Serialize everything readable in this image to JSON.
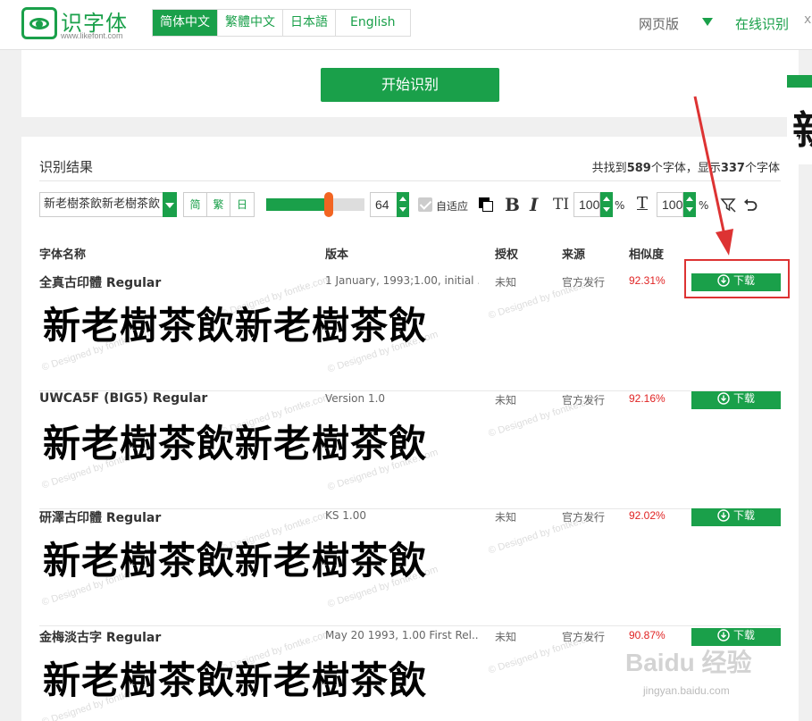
{
  "header": {
    "logo_title": "识字体",
    "logo_url": "www.likefont.com",
    "lang_tabs": [
      "简体中文",
      "繁體中文",
      "日本語",
      "English"
    ],
    "web_version": "网页版",
    "online_recognize": "在线识别",
    "close_glyph": "x"
  },
  "start": {
    "button_label": "开始识别"
  },
  "floater_glyph": "新",
  "results": {
    "title": "识别结果",
    "count_prefix": "共找到",
    "found": "589",
    "count_mid": "个字体，显示",
    "shown": "337",
    "count_suffix": "个字体"
  },
  "toolbar": {
    "sample_text": "新老樹茶飲新老樹茶飲",
    "script_buttons": [
      "简",
      "繁",
      "日"
    ],
    "size_slider_fraction": 0.64,
    "font_size": "64",
    "auto_fit_label": "自适应",
    "bold": "B",
    "italic": "I",
    "text_size_icon": "TI",
    "text_size_pct": "100",
    "letter_spacing_icon": "T",
    "letter_spacing_pct": "100",
    "pct_sign": "%"
  },
  "table": {
    "headers": [
      "字体名称",
      "版本",
      "授权",
      "来源",
      "相似度"
    ],
    "download_label": "下载",
    "preview_text": "新老樹茶飲新老樹茶飲",
    "rows": [
      {
        "name": "全真古印體 Regular",
        "version": "1 January, 1993;1.00, initial ...",
        "license": "未知",
        "source": "官方发行",
        "similarity": "92.31%"
      },
      {
        "name": "UWCA5F (BIG5) Regular",
        "version": "Version 1.0",
        "license": "未知",
        "source": "官方发行",
        "similarity": "92.16%"
      },
      {
        "name": "研澤古印體 Regular",
        "version": "KS 1.00",
        "license": "未知",
        "source": "官方发行",
        "similarity": "92.02%"
      },
      {
        "name": "金梅淡古字 Regular",
        "version": "May 20 1993, 1.00 First Rel...",
        "license": "未知",
        "source": "官方发行",
        "similarity": "90.87%"
      }
    ]
  },
  "watermark": {
    "text": "© Designed by fontke.com",
    "baidu": "Baidu 经验",
    "baidu_url": "jingyan.baidu.com"
  },
  "colors": {
    "brand": "#1aa04a",
    "accent": "#f26522",
    "similarity": "#e02424",
    "annotation": "#dd3333"
  }
}
